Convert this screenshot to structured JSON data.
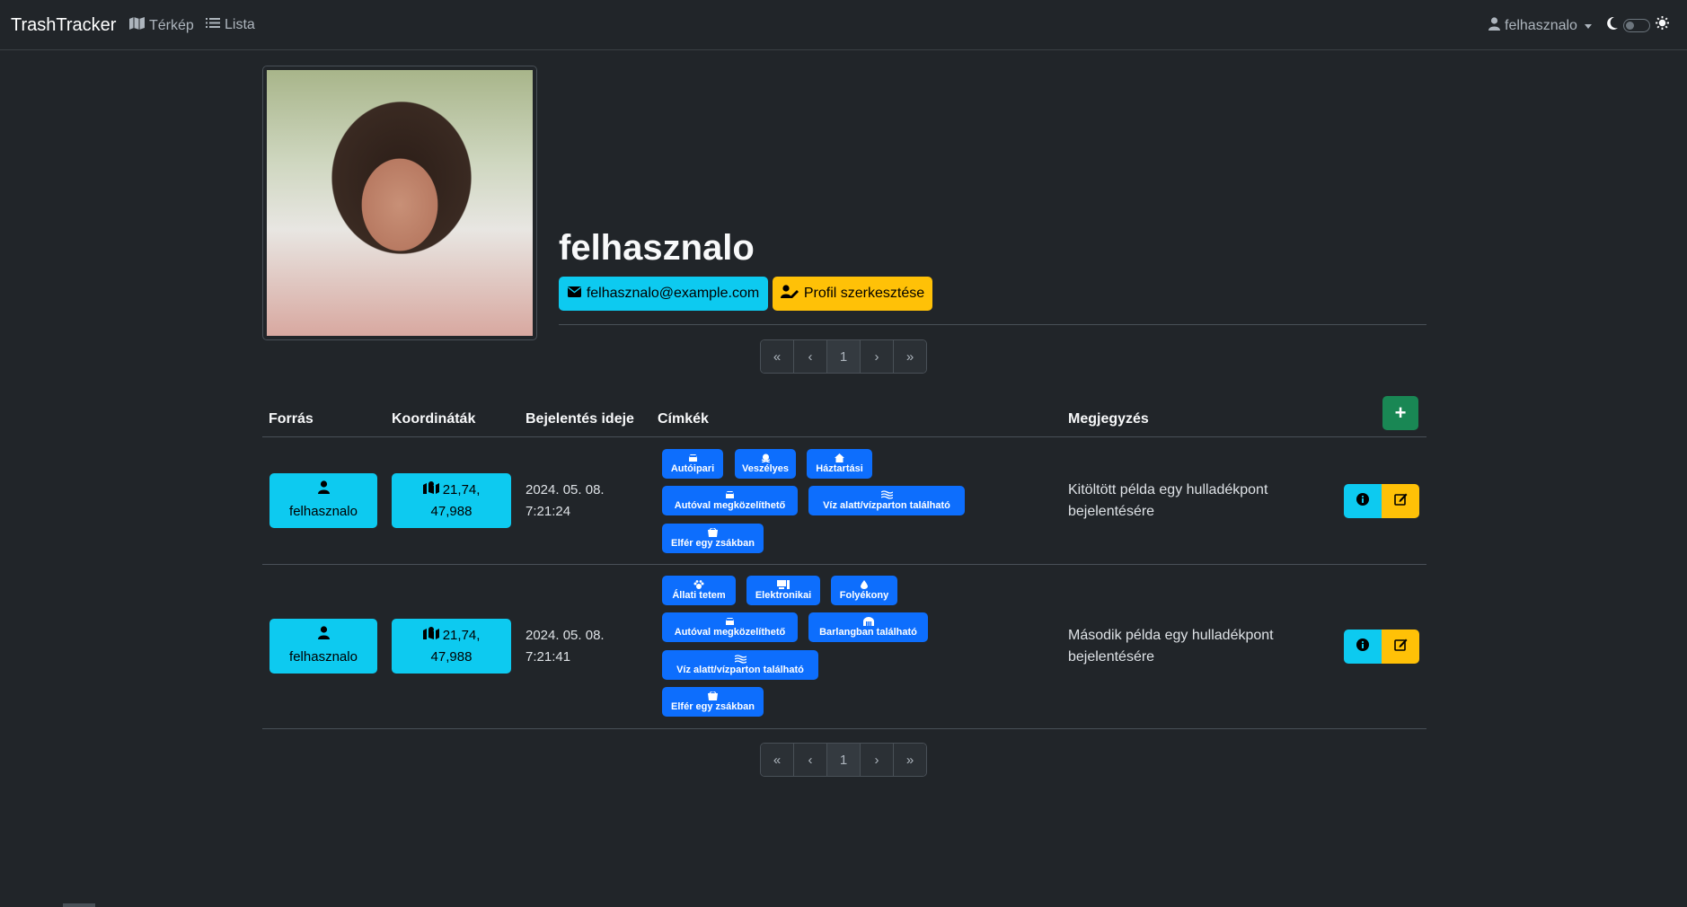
{
  "navbar": {
    "brand": "TrashTracker",
    "map_label": "Térkép",
    "list_label": "Lista",
    "user_label": "felhasznalo"
  },
  "profile": {
    "username": "felhasznalo",
    "email": "felhasznalo@example.com",
    "edit_label": "Profil szerkesztése"
  },
  "pagination": {
    "first": "«",
    "prev": "‹",
    "page": "1",
    "next": "›",
    "last": "»"
  },
  "table": {
    "columns": [
      "Forrás",
      "Koordináták",
      "Bejelentés ideje",
      "Címkék",
      "Megjegyzés"
    ],
    "add_label": "+",
    "rows": [
      {
        "source": "felhasznalo",
        "coords_line1": "21,74,",
        "coords_line2": "47,988",
        "date_line1": "2024. 05. 08.",
        "time_line2": "7:21:24",
        "tags": [
          "Autóipari",
          "Veszélyes",
          "Háztartási",
          "Autóval megközelíthető",
          "Víz alatt/vízparton található",
          "Elfér egy zsákban"
        ],
        "note": "Kitöltött példa egy hulladékpont bejelentésére"
      },
      {
        "source": "felhasznalo",
        "coords_line1": "21,74,",
        "coords_line2": "47,988",
        "date_line1": "2024. 05. 08.",
        "time_line2": "7:21:41",
        "tags": [
          "Állati tetem",
          "Elektronikai",
          "Folyékony",
          "Autóval megközelíthető",
          "Barlangban található",
          "Víz alatt/vízparton található",
          "Elfér egy zsákban"
        ],
        "note": "Második példa egy hulladékpont bejelentésére"
      }
    ]
  },
  "colors": {
    "background": "#212529",
    "info": "#0dcaf0",
    "warning": "#ffc107",
    "primary": "#0d6efd",
    "success": "#198754"
  }
}
